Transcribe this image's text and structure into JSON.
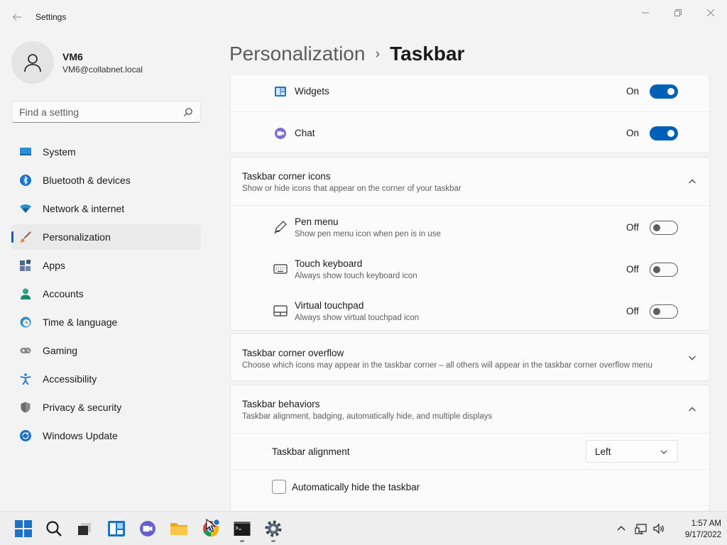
{
  "window": {
    "app_title": "Settings"
  },
  "profile": {
    "name": "VM6",
    "email": "VM6@collabnet.local"
  },
  "search": {
    "placeholder": "Find a setting",
    "value": ""
  },
  "sidebar": {
    "items": [
      {
        "label": "System",
        "icon": "monitor-icon"
      },
      {
        "label": "Bluetooth & devices",
        "icon": "bluetooth-icon"
      },
      {
        "label": "Network & internet",
        "icon": "wifi-icon"
      },
      {
        "label": "Personalization",
        "icon": "brush-icon",
        "active": true
      },
      {
        "label": "Apps",
        "icon": "apps-icon"
      },
      {
        "label": "Accounts",
        "icon": "person-icon"
      },
      {
        "label": "Time & language",
        "icon": "clock-globe-icon"
      },
      {
        "label": "Gaming",
        "icon": "gamepad-icon"
      },
      {
        "label": "Accessibility",
        "icon": "accessibility-icon"
      },
      {
        "label": "Privacy & security",
        "icon": "shield-icon"
      },
      {
        "label": "Windows Update",
        "icon": "update-icon"
      }
    ]
  },
  "header": {
    "parent": "Personalization",
    "separator": "›",
    "current": "Taskbar"
  },
  "taskbar_items": {
    "widgets": {
      "label": "Widgets",
      "state": "On",
      "on": true
    },
    "chat": {
      "label": "Chat",
      "state": "On",
      "on": true
    }
  },
  "corner_icons": {
    "title": "Taskbar corner icons",
    "subtitle": "Show or hide icons that appear on the corner of your taskbar",
    "expanded": true,
    "items": [
      {
        "title": "Pen menu",
        "subtitle": "Show pen menu icon when pen is in use",
        "state": "Off",
        "on": false
      },
      {
        "title": "Touch keyboard",
        "subtitle": "Always show touch keyboard icon",
        "state": "Off",
        "on": false
      },
      {
        "title": "Virtual touchpad",
        "subtitle": "Always show virtual touchpad icon",
        "state": "Off",
        "on": false
      }
    ]
  },
  "corner_overflow": {
    "title": "Taskbar corner overflow",
    "subtitle": "Choose which icons may appear in the taskbar corner – all others will appear in the taskbar corner overflow menu",
    "expanded": false
  },
  "behaviors": {
    "title": "Taskbar behaviors",
    "subtitle": "Taskbar alignment, badging, automatically hide, and multiple displays",
    "expanded": true,
    "alignment_label": "Taskbar alignment",
    "alignment_value": "Left",
    "autohide_label": "Automatically hide the taskbar",
    "autohide_checked": false
  },
  "system_taskbar": {
    "time": "1:57 AM",
    "date": "9/17/2022"
  },
  "colors": {
    "accent": "#005fb8",
    "background": "#f3f3f3",
    "card": "#fbfbfb"
  }
}
